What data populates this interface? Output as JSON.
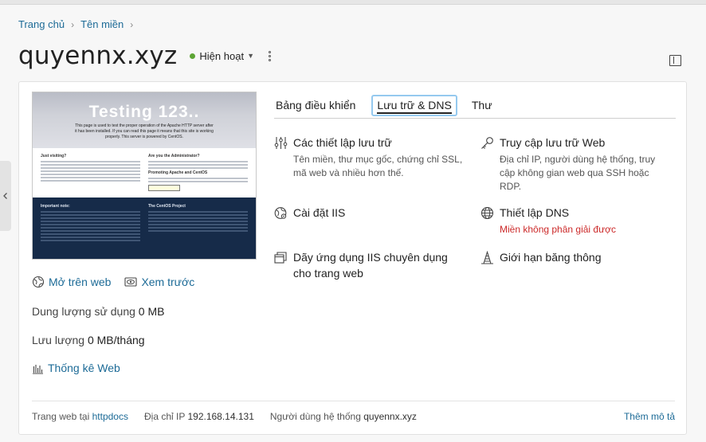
{
  "breadcrumb": {
    "home": "Trang chủ",
    "domains": "Tên miền"
  },
  "domain": {
    "name": "quyennx.xyz",
    "status": "Hiện hoạt"
  },
  "preview": {
    "title": "Testing 123..",
    "subtitle": "This page is used to test the proper operation of the Apache HTTP server after it has been installed. If you can read this page it means that this site is working properly. This server is powered by CentOS.",
    "col1_heading": "Just visiting?",
    "col2_heading": "Are you the Administrator?",
    "col2_heading2": "Promoting Apache and CentOS",
    "dark1_heading": "Important note:",
    "dark2_heading": "The CentOS Project"
  },
  "links": {
    "open_web": "Mở trên web",
    "preview": "Xem trước"
  },
  "stats": {
    "disk_label": "Dung lượng sử dụng",
    "disk_value": "0 MB",
    "traffic_label": "Lưu lượng",
    "traffic_value": "0 MB/tháng",
    "web_stats": "Thống kê Web"
  },
  "tabs": [
    {
      "label": "Bảng điều khiển"
    },
    {
      "label": "Lưu trữ & DNS"
    },
    {
      "label": "Thư"
    }
  ],
  "tools": {
    "hosting_settings": {
      "title": "Các thiết lập lưu trữ",
      "desc": "Tên miền, thư mục gốc, chứng chỉ SSL, mã web và nhiều hơn thế."
    },
    "web_hosting_access": {
      "title": "Truy cập lưu trữ Web",
      "desc": "Địa chỉ IP, người dùng hệ thống, truy cập không gian web qua SSH hoặc RDP."
    },
    "iis_settings": {
      "title": "Cài đặt IIS"
    },
    "dns_settings": {
      "title": "Thiết lập DNS",
      "desc": "Miền không phân giải được"
    },
    "iis_pool": {
      "title": "Dãy ứng dụng IIS chuyên dụng cho trang web"
    },
    "bandwidth": {
      "title": "Giới hạn băng thông"
    }
  },
  "footer": {
    "site_label": "Trang web tại",
    "site_value": "httpdocs",
    "ip_label": "Địa chỉ IP",
    "ip_value": "192.168.14.131",
    "user_label": "Người dùng hệ thống",
    "user_value": "quyennx.xyz",
    "more": "Thêm mô tả"
  },
  "colors": {
    "accent": "#1d6b97",
    "status_active": "#5da535",
    "error": "#cc2a2a",
    "tab_focus": "#95c9ef"
  }
}
